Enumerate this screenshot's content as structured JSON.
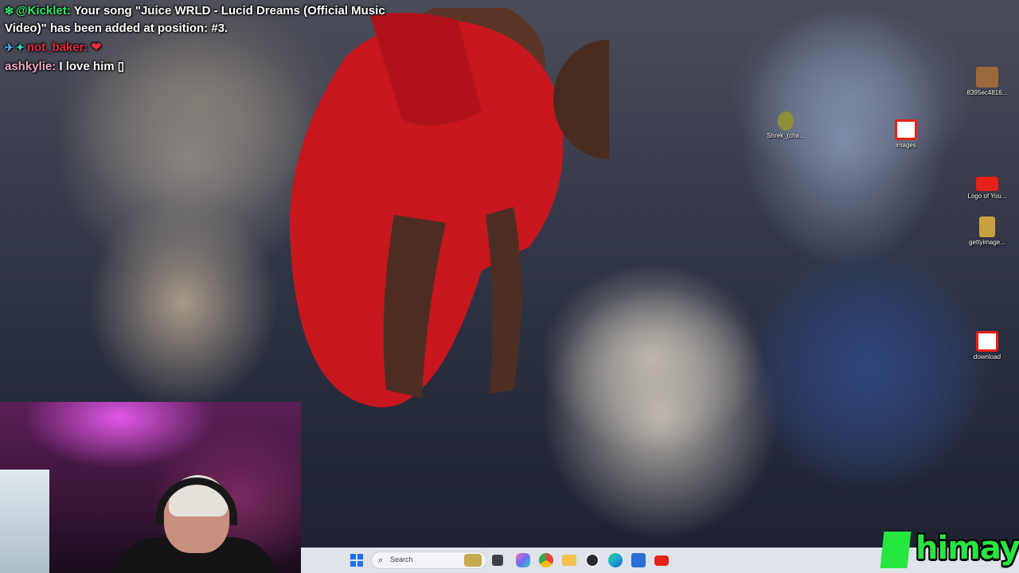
{
  "chat": {
    "messages": [
      {
        "badge": "❇",
        "user": "@Kicklet:",
        "user_color": "#2ee86a",
        "text": " Your song \"Juice WRLD - Lucid Dreams (Official Music Video)\" has been added at position: #3."
      },
      {
        "badge": "✈",
        "badge2": "✦",
        "user": "not_baker:",
        "user_color": "#e52a3c",
        "text": " ❤"
      },
      {
        "user": "ashkylie:",
        "user_color": "#f2a7c3",
        "text": " I love him ▯"
      }
    ]
  },
  "desktop_icons": [
    {
      "label": "8395ec4816...",
      "icon": "image-thumbnail-icon",
      "color": "#9c6a3a"
    },
    {
      "label": "Shrek_(cha...",
      "icon": "shrek-character-icon",
      "color": "#8d8f3a"
    },
    {
      "label": "images",
      "icon": "youtube-image-icon",
      "color": "#e62117"
    },
    {
      "label": "Logo of You...",
      "icon": "youtube-logo-icon",
      "color": "#e62117"
    },
    {
      "label": "gettyimage...",
      "icon": "image-thumbnail-icon",
      "color": "#c9a040"
    },
    {
      "label": "download",
      "icon": "youtube-download-icon",
      "color": "#e62117"
    }
  ],
  "taskbar": {
    "search_placeholder": "Search",
    "apps": [
      {
        "name": "task-view-icon",
        "color": "#3a3f4a"
      },
      {
        "name": "copilot-icon",
        "color": "#6f6cf3"
      },
      {
        "name": "chrome-icon",
        "color": "#34a853"
      },
      {
        "name": "file-explorer-icon",
        "color": "#f2c14e"
      },
      {
        "name": "obs-studio-icon",
        "color": "#2a2a2a"
      },
      {
        "name": "edge-icon",
        "color": "#1aa7d4"
      },
      {
        "name": "microsoft-store-icon",
        "color": "#2b6fd6"
      },
      {
        "name": "youtube-icon",
        "color": "#e62117"
      }
    ]
  },
  "logo": {
    "text": "himay",
    "color": "#27e640"
  }
}
